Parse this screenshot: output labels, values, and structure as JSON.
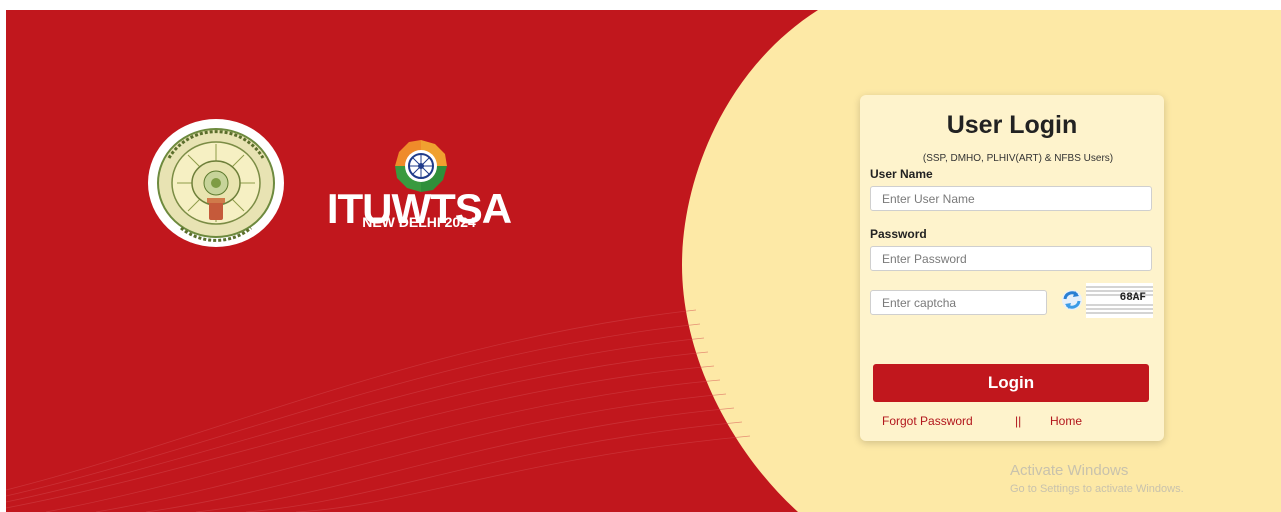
{
  "brand": {
    "itu_title": "ITUWTSA",
    "itu_subtitle": "NEW DELHI 2024"
  },
  "login": {
    "title": "User Login",
    "subtitle": "(SSP, DMHO, PLHIV(ART) & NFBS Users)",
    "username_label": "User Name",
    "username_placeholder": "Enter User Name",
    "username_value": "",
    "password_label": "Password",
    "password_placeholder": "Enter Password",
    "password_value": "",
    "captcha_placeholder": "Enter captcha",
    "captcha_value": "",
    "captcha_code": "68AF",
    "button_label": "Login",
    "forgot_label": "Forgot Password",
    "separator": "||",
    "home_label": "Home"
  },
  "watermark": {
    "line1": "Activate Windows",
    "line2": "Go to Settings to activate Windows."
  },
  "colors": {
    "brand_red": "#c1171d",
    "cream": "#fde9a6",
    "card": "#fef3cc"
  },
  "icons": [
    "state-emblem-seal",
    "itu-ashoka-chakra-logo",
    "refresh-captcha-icon"
  ]
}
